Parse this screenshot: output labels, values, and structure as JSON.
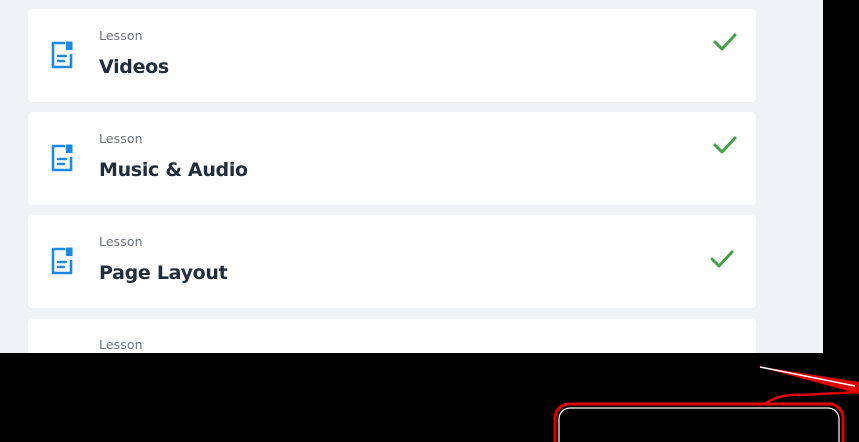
{
  "lessons": [
    {
      "type": "Lesson",
      "title": "Videos",
      "completed": true
    },
    {
      "type": "Lesson",
      "title": "Music & Audio",
      "completed": true
    },
    {
      "type": "Lesson",
      "title": "Page Layout",
      "completed": true
    },
    {
      "type": "Lesson",
      "title": "",
      "completed": false
    }
  ],
  "colors": {
    "background": "#f0f2f5",
    "card": "#ffffff",
    "icon": "#1e88e5",
    "check": "#43a047",
    "title": "#1f2d3d",
    "type_label": "#6b7480",
    "annotation": "#e00000"
  },
  "icons": {
    "lesson": "document-bookmark-icon",
    "status": "checkmark-icon"
  }
}
